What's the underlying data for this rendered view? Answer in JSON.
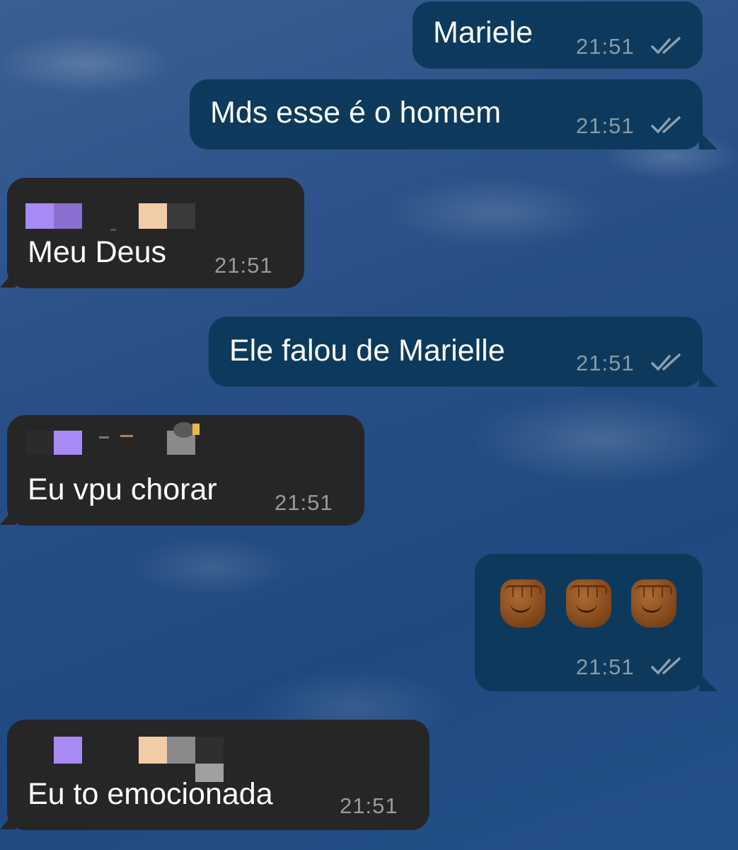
{
  "messages": [
    {
      "direction": "out",
      "text": "Mariele",
      "time": "21:51",
      "status": "read-double-check"
    },
    {
      "direction": "out",
      "text": "Mds esse é o homem",
      "time": "21:51",
      "status": "read-double-check"
    },
    {
      "direction": "in",
      "sender": "redacted",
      "text": "Meu Deus",
      "time": "21:51"
    },
    {
      "direction": "out",
      "text": "Ele falou de Marielle",
      "time": "21:51",
      "status": "read-double-check"
    },
    {
      "direction": "in",
      "sender": "redacted",
      "text": "Eu vpu chorar",
      "time": "21:51"
    },
    {
      "direction": "out",
      "emoji": [
        "raised-fist-medium-dark",
        "raised-fist-medium-dark",
        "raised-fist-medium-dark"
      ],
      "time": "21:51",
      "status": "read-double-check"
    },
    {
      "direction": "in",
      "sender": "redacted",
      "text": "Eu to emocionada",
      "time": "21:51"
    }
  ],
  "colors": {
    "outgoing_bubble": "#0d3a5c",
    "incoming_bubble": "#262626",
    "timestamp": "#8a9aa8",
    "read_ticks": "#8fa0ae",
    "redaction_purple": "#a98af5",
    "redaction_skin": "#f1cca6"
  }
}
